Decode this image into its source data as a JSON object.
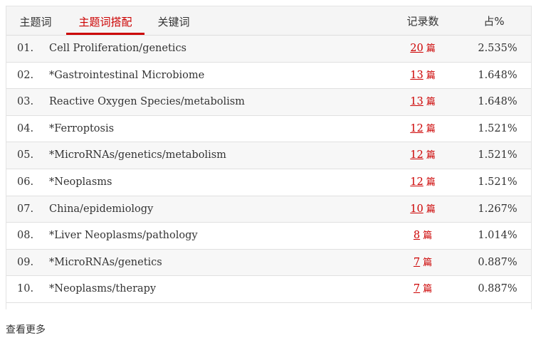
{
  "tabs": [
    {
      "label": "主题词",
      "active": false
    },
    {
      "label": "主题词搭配",
      "active": true
    },
    {
      "label": "关键词",
      "active": false
    }
  ],
  "columns": {
    "count": "记录数",
    "percent": "占%"
  },
  "unit": "篇",
  "rows": [
    {
      "num": "01.",
      "term": "Cell Proliferation/genetics",
      "count": "20",
      "percent": "2.535%"
    },
    {
      "num": "02.",
      "term": "*Gastrointestinal Microbiome",
      "count": "13",
      "percent": "1.648%"
    },
    {
      "num": "03.",
      "term": "Reactive Oxygen Species/metabolism",
      "count": "13",
      "percent": "1.648%"
    },
    {
      "num": "04.",
      "term": "*Ferroptosis",
      "count": "12",
      "percent": "1.521%"
    },
    {
      "num": "05.",
      "term": "*MicroRNAs/genetics/metabolism",
      "count": "12",
      "percent": "1.521%"
    },
    {
      "num": "06.",
      "term": "*Neoplasms",
      "count": "12",
      "percent": "1.521%"
    },
    {
      "num": "07.",
      "term": "China/epidemiology",
      "count": "10",
      "percent": "1.267%"
    },
    {
      "num": "08.",
      "term": "*Liver Neoplasms/pathology",
      "count": "8",
      "percent": "1.014%"
    },
    {
      "num": "09.",
      "term": "*MicroRNAs/genetics",
      "count": "7",
      "percent": "0.887%"
    },
    {
      "num": "10.",
      "term": "*Neoplasms/therapy",
      "count": "7",
      "percent": "0.887%"
    }
  ],
  "more_label": "查看更多"
}
